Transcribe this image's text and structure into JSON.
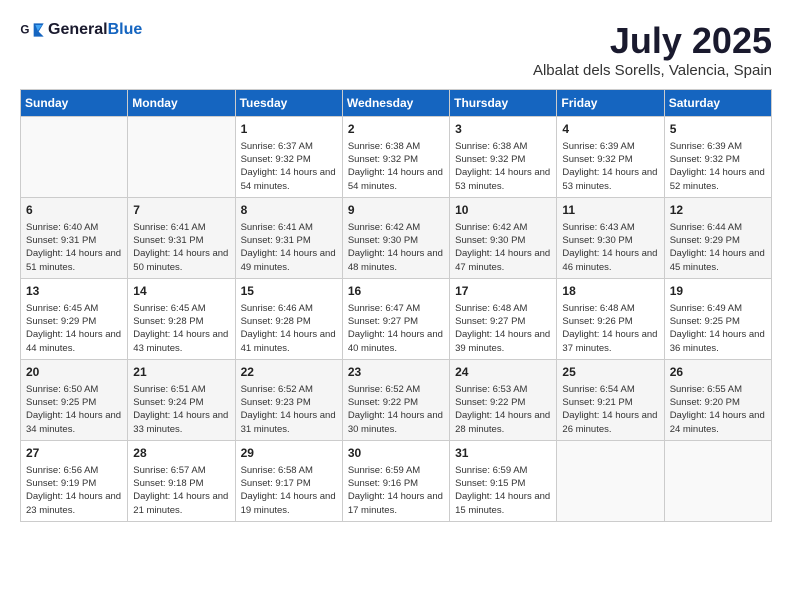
{
  "header": {
    "logo": {
      "general": "General",
      "blue": "Blue"
    },
    "title": "July 2025",
    "subtitle": "Albalat dels Sorells, Valencia, Spain"
  },
  "days_of_week": [
    "Sunday",
    "Monday",
    "Tuesday",
    "Wednesday",
    "Thursday",
    "Friday",
    "Saturday"
  ],
  "weeks": [
    [
      {
        "day": null
      },
      {
        "day": null
      },
      {
        "day": "1",
        "sunrise": "6:37 AM",
        "sunset": "9:32 PM",
        "daylight": "14 hours and 54 minutes."
      },
      {
        "day": "2",
        "sunrise": "6:38 AM",
        "sunset": "9:32 PM",
        "daylight": "14 hours and 54 minutes."
      },
      {
        "day": "3",
        "sunrise": "6:38 AM",
        "sunset": "9:32 PM",
        "daylight": "14 hours and 53 minutes."
      },
      {
        "day": "4",
        "sunrise": "6:39 AM",
        "sunset": "9:32 PM",
        "daylight": "14 hours and 53 minutes."
      },
      {
        "day": "5",
        "sunrise": "6:39 AM",
        "sunset": "9:32 PM",
        "daylight": "14 hours and 52 minutes."
      }
    ],
    [
      {
        "day": "6",
        "sunrise": "6:40 AM",
        "sunset": "9:31 PM",
        "daylight": "14 hours and 51 minutes."
      },
      {
        "day": "7",
        "sunrise": "6:41 AM",
        "sunset": "9:31 PM",
        "daylight": "14 hours and 50 minutes."
      },
      {
        "day": "8",
        "sunrise": "6:41 AM",
        "sunset": "9:31 PM",
        "daylight": "14 hours and 49 minutes."
      },
      {
        "day": "9",
        "sunrise": "6:42 AM",
        "sunset": "9:30 PM",
        "daylight": "14 hours and 48 minutes."
      },
      {
        "day": "10",
        "sunrise": "6:42 AM",
        "sunset": "9:30 PM",
        "daylight": "14 hours and 47 minutes."
      },
      {
        "day": "11",
        "sunrise": "6:43 AM",
        "sunset": "9:30 PM",
        "daylight": "14 hours and 46 minutes."
      },
      {
        "day": "12",
        "sunrise": "6:44 AM",
        "sunset": "9:29 PM",
        "daylight": "14 hours and 45 minutes."
      }
    ],
    [
      {
        "day": "13",
        "sunrise": "6:45 AM",
        "sunset": "9:29 PM",
        "daylight": "14 hours and 44 minutes."
      },
      {
        "day": "14",
        "sunrise": "6:45 AM",
        "sunset": "9:28 PM",
        "daylight": "14 hours and 43 minutes."
      },
      {
        "day": "15",
        "sunrise": "6:46 AM",
        "sunset": "9:28 PM",
        "daylight": "14 hours and 41 minutes."
      },
      {
        "day": "16",
        "sunrise": "6:47 AM",
        "sunset": "9:27 PM",
        "daylight": "14 hours and 40 minutes."
      },
      {
        "day": "17",
        "sunrise": "6:48 AM",
        "sunset": "9:27 PM",
        "daylight": "14 hours and 39 minutes."
      },
      {
        "day": "18",
        "sunrise": "6:48 AM",
        "sunset": "9:26 PM",
        "daylight": "14 hours and 37 minutes."
      },
      {
        "day": "19",
        "sunrise": "6:49 AM",
        "sunset": "9:25 PM",
        "daylight": "14 hours and 36 minutes."
      }
    ],
    [
      {
        "day": "20",
        "sunrise": "6:50 AM",
        "sunset": "9:25 PM",
        "daylight": "14 hours and 34 minutes."
      },
      {
        "day": "21",
        "sunrise": "6:51 AM",
        "sunset": "9:24 PM",
        "daylight": "14 hours and 33 minutes."
      },
      {
        "day": "22",
        "sunrise": "6:52 AM",
        "sunset": "9:23 PM",
        "daylight": "14 hours and 31 minutes."
      },
      {
        "day": "23",
        "sunrise": "6:52 AM",
        "sunset": "9:22 PM",
        "daylight": "14 hours and 30 minutes."
      },
      {
        "day": "24",
        "sunrise": "6:53 AM",
        "sunset": "9:22 PM",
        "daylight": "14 hours and 28 minutes."
      },
      {
        "day": "25",
        "sunrise": "6:54 AM",
        "sunset": "9:21 PM",
        "daylight": "14 hours and 26 minutes."
      },
      {
        "day": "26",
        "sunrise": "6:55 AM",
        "sunset": "9:20 PM",
        "daylight": "14 hours and 24 minutes."
      }
    ],
    [
      {
        "day": "27",
        "sunrise": "6:56 AM",
        "sunset": "9:19 PM",
        "daylight": "14 hours and 23 minutes."
      },
      {
        "day": "28",
        "sunrise": "6:57 AM",
        "sunset": "9:18 PM",
        "daylight": "14 hours and 21 minutes."
      },
      {
        "day": "29",
        "sunrise": "6:58 AM",
        "sunset": "9:17 PM",
        "daylight": "14 hours and 19 minutes."
      },
      {
        "day": "30",
        "sunrise": "6:59 AM",
        "sunset": "9:16 PM",
        "daylight": "14 hours and 17 minutes."
      },
      {
        "day": "31",
        "sunrise": "6:59 AM",
        "sunset": "9:15 PM",
        "daylight": "14 hours and 15 minutes."
      },
      {
        "day": null
      },
      {
        "day": null
      }
    ]
  ]
}
